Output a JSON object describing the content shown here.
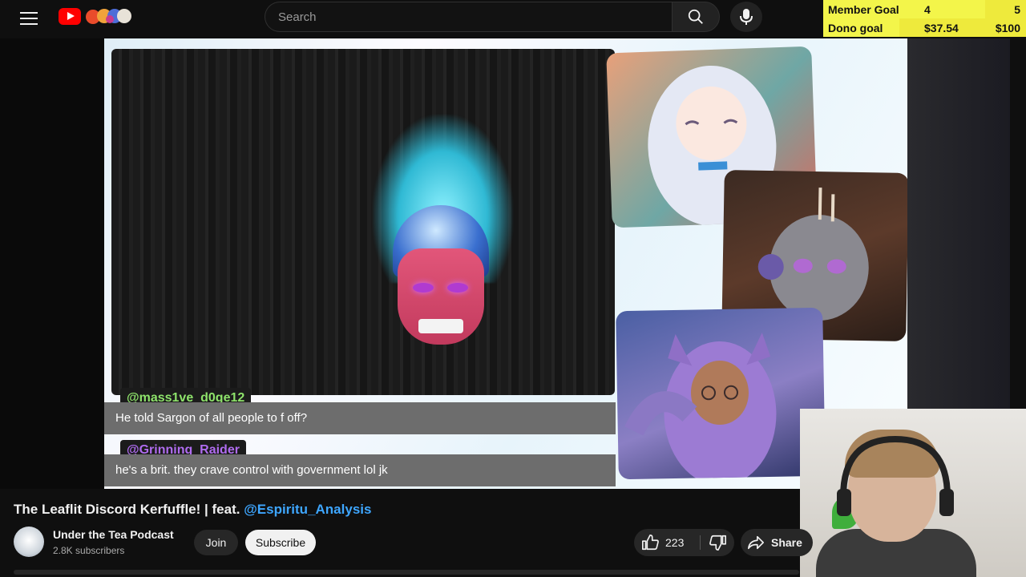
{
  "header": {
    "search_placeholder": "Search",
    "icons": [
      "menu-icon",
      "youtube-logo",
      "search-icon",
      "mic-icon"
    ]
  },
  "goals": {
    "member": {
      "label": "Member Goal",
      "current": "4",
      "target": "5",
      "progress": 0.8
    },
    "dono": {
      "label": "Dono goal",
      "current": "$37.54",
      "target": "$100",
      "progress": 0.3754
    }
  },
  "chat": [
    {
      "user": "@mass1ve_d0ge12",
      "message": "He told Sargon of all people to f off?",
      "name_color": "#8ee36b"
    },
    {
      "user": "@Grinning_Raider",
      "message": "he's a brit. they crave control with government lol jk",
      "name_color": "#b06cf0"
    }
  ],
  "video": {
    "title": "The Leaflit Discord Kerfuffle! | feat.",
    "title_mention": "@Espiritu_Analysis"
  },
  "channel": {
    "name": "Under the Tea Podcast",
    "subscribers": "2.8K subscribers",
    "join_label": "Join",
    "subscribe_label": "Subscribe"
  },
  "actions": {
    "like_count": "223",
    "share_label": "Share"
  },
  "colors": {
    "accent": "#3ea6ff",
    "goal_bg": "#eeea3c",
    "goal_fill": "#f3f54a"
  }
}
